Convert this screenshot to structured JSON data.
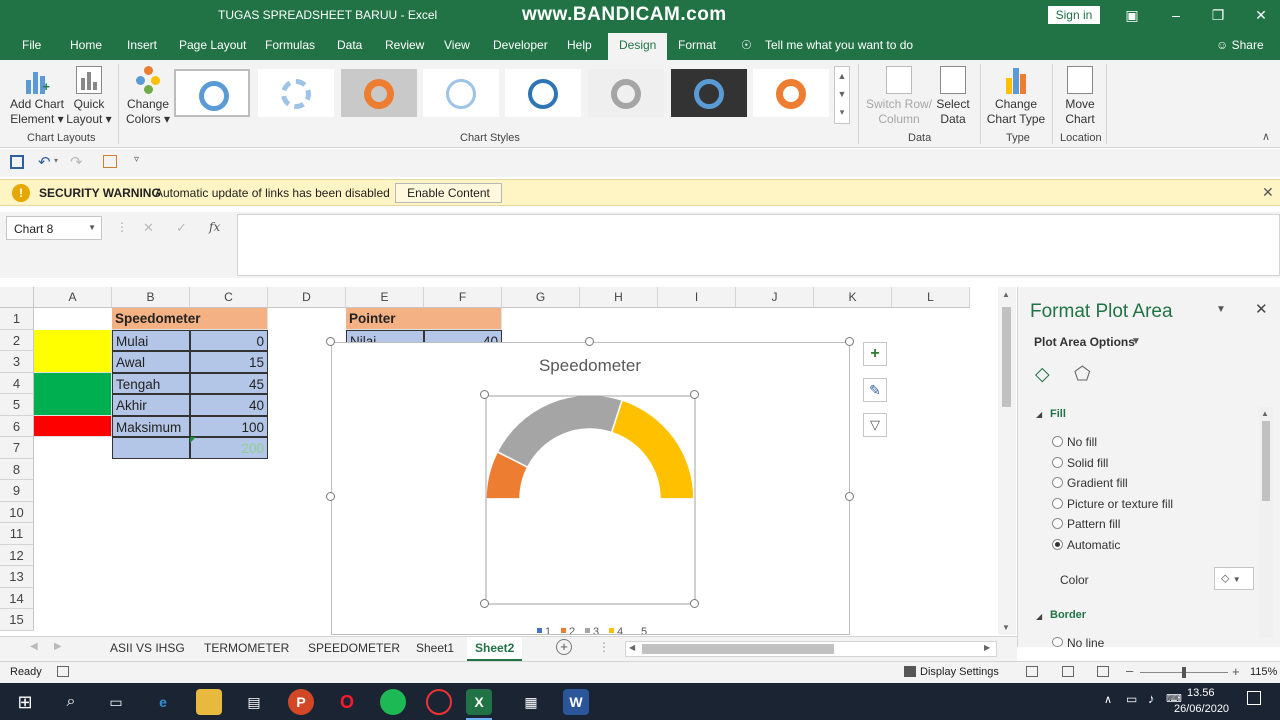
{
  "window": {
    "title": "TUGAS SPREADSHEET BARUU  -  Excel",
    "watermark": "www.BANDICAM.com",
    "signin": "Sign in",
    "share": "Share"
  },
  "tabs": [
    "File",
    "Home",
    "Insert",
    "Page Layout",
    "Formulas",
    "Data",
    "Review",
    "View",
    "Developer",
    "Help",
    "Design",
    "Format"
  ],
  "active_tab": "Design",
  "tell_me": "Tell me what you want to do",
  "ribbon": {
    "add_chart_element": [
      "Add Chart",
      "Element ▾"
    ],
    "quick_layout": [
      "Quick",
      "Layout ▾"
    ],
    "change_colors": [
      "Change",
      "Colors ▾"
    ],
    "switch_row_column": [
      "Switch Row/",
      "Column"
    ],
    "select_data": [
      "Select",
      "Data"
    ],
    "change_chart_type": [
      "Change",
      "Chart Type"
    ],
    "move_chart": [
      "Move",
      "Chart"
    ],
    "groups": {
      "chart_layouts": "Chart Layouts",
      "chart_styles": "Chart Styles",
      "data": "Data",
      "type": "Type",
      "location": "Location"
    }
  },
  "security": {
    "label": "SECURITY WARNING",
    "message": "Automatic update of links has been disabled",
    "button": "Enable Content"
  },
  "namebox": "Chart 8",
  "fx": "fx",
  "columns": [
    "A",
    "B",
    "C",
    "D",
    "E",
    "F",
    "G",
    "H",
    "I",
    "J",
    "K",
    "L"
  ],
  "rows": [
    "1",
    "2",
    "3",
    "4",
    "5",
    "6",
    "7",
    "8",
    "9",
    "10",
    "11",
    "12",
    "13",
    "14",
    "15"
  ],
  "cells": {
    "b1": "Speedometer",
    "b2": "Mulai",
    "c2": "0",
    "b3": "Awal",
    "c3": "15",
    "b4": "Tengah",
    "c4": "45",
    "b5": "Akhir",
    "c5": "40",
    "b6": "Maksimum",
    "c6": "100",
    "c7": "200",
    "e1": "Pointer",
    "e2": "Nilai",
    "f2": "40"
  },
  "colors": {
    "excel_green": "#217346",
    "a_yellow": "#ffff00",
    "a_green": "#00b050",
    "a_red": "#ff0000",
    "cell_blue": "#b4c6e7",
    "cell_orange": "#f4b183",
    "donut_orange": "#ed7d31",
    "donut_gray": "#a5a5a5",
    "donut_gold": "#ffc000"
  },
  "chart_data": {
    "type": "pie",
    "title": "Speedometer",
    "categories": [
      "1",
      "2",
      "3",
      "4",
      "5"
    ],
    "values": [
      0,
      15,
      45,
      40,
      100
    ],
    "colors": [
      "#4472c4",
      "#ed7d31",
      "#a5a5a5",
      "#ffc000",
      "#ffffff"
    ],
    "legend": "bottom"
  },
  "pane": {
    "title": "Format Plot Area",
    "options": "Plot Area Options",
    "fill_header": "Fill",
    "fill_options": [
      "No fill",
      "Solid fill",
      "Gradient fill",
      "Picture or texture fill",
      "Pattern fill",
      "Automatic"
    ],
    "selected_fill": "Automatic",
    "color_label": "Color",
    "border_header": "Border",
    "border_first": "No line"
  },
  "sheets": [
    "ASII VS IHSG",
    "TERMOMETER",
    "SPEEDOMETER",
    "Sheet1",
    "Sheet2"
  ],
  "active_sheet": "Sheet2",
  "status": {
    "ready": "Ready",
    "display_settings": "Display Settings",
    "zoom": "115%"
  },
  "clock": {
    "time": "13.56",
    "date": "26/06/2020"
  }
}
